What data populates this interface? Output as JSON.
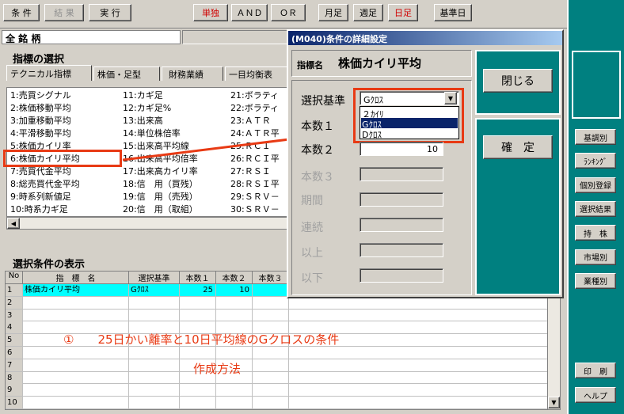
{
  "toolbar": {
    "jouken": "条 件",
    "kekka": "結 果",
    "jikkou": "実 行",
    "tandoku": "単独",
    "and": "ＡＮＤ",
    "or": "ＯＲ",
    "tsukiashi": "月足",
    "shuuashi": "週足",
    "hiashi": "日足",
    "kijunbi": "基準日"
  },
  "stock_label": "全 銘 柄",
  "indicator_section": {
    "title": "指標の選択",
    "tabs": [
      "テクニカル指標",
      "株価・足型",
      "財務業績",
      "一目均衡表"
    ],
    "col1": [
      "1:売買シグナル",
      "2:株価移動平均",
      "3:加重移動平均",
      "4:平滑移動平均",
      "5:株価カイリ率",
      "6:株価カイリ平均",
      "7:売買代金平均",
      "8:総売買代金平均",
      "9:時系列新値足",
      "10:時系力ギ足"
    ],
    "col2": [
      "11:カギ足",
      "12:カギ足%",
      "13:出来高",
      "14:単位株倍率",
      "15:出来高平均線",
      "16:出来高平均倍率",
      "17:出来高カイリ率",
      "18:信　用（買残）",
      "19:信　用（売残）",
      "20:信　用（取組）"
    ],
    "col3": [
      "21:ボラティ",
      "22:ボラティ",
      "23:ＡＴＲ",
      "24:ＡＴＲ平",
      "25:ＲＣＩ",
      "26:ＲＣＩ平",
      "27:ＲＳＩ",
      "28:ＲＳＩ平",
      "29:ＳＲＶ－",
      "30:ＳＲＶ－"
    ]
  },
  "condition_section": {
    "title": "選択条件の表示",
    "headers": [
      "No",
      "指　標　名",
      "選択基準",
      "本数１",
      "本数２",
      "本数３"
    ],
    "rows": [
      {
        "no": "1",
        "name": "株価カイリ平均",
        "kijun": "Gｸﾛｽ",
        "h1": "25",
        "h2": "10",
        "h3": ""
      },
      {
        "no": "2"
      },
      {
        "no": "3"
      },
      {
        "no": "4"
      },
      {
        "no": "5"
      },
      {
        "no": "6"
      },
      {
        "no": "7"
      },
      {
        "no": "8"
      },
      {
        "no": "9"
      },
      {
        "no": "10"
      }
    ]
  },
  "annotation": {
    "line1": "①　　25日かい離率と10日平均線のGクロスの条件",
    "line2": "作成方法"
  },
  "dialog": {
    "title": "(M040)条件の詳細設定",
    "shihyo_label": "指標名",
    "shihyo_value": "株価カイリ平均",
    "kijun_label": "選択基準",
    "kijun_selected": "Gｸﾛｽ",
    "kijun_options": [
      "２ｶｲﾘ",
      "Gｸﾛｽ",
      "Dｸﾛｽ"
    ],
    "honsu1_label": "本数１",
    "honsu2_label": "本数２",
    "honsu2_value": "10",
    "honsu3_label": "本数３",
    "kikan_label": "期間",
    "renzoku_label": "連続",
    "ijou_label": "以上",
    "ika_label": "以下",
    "close_button": "閉じる",
    "confirm_button": "確　定"
  },
  "sidebar": {
    "items": [
      "基調別",
      "ﾗﾝｷﾝｸﾞ",
      "個別登録",
      "選択結果",
      "持　株",
      "市場別",
      "業種別"
    ],
    "print": "印　刷",
    "help": "ヘルプ"
  },
  "colors": {
    "highlight_red": "#e83a14",
    "selection_blue": "#0a246a",
    "row_cyan": "#00ffff",
    "annotation_text": "#e83a14"
  }
}
